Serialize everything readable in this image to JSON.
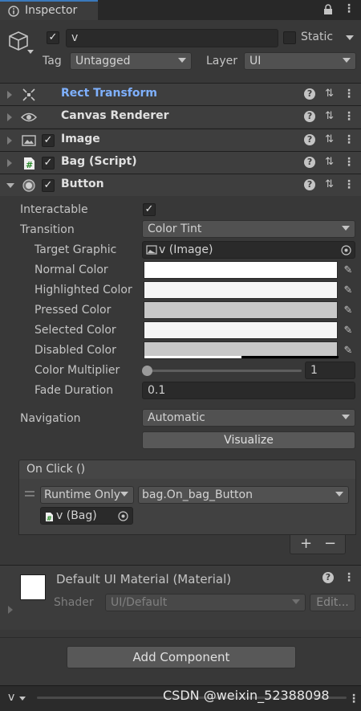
{
  "tab": {
    "title": "Inspector"
  },
  "object": {
    "name": "v",
    "static_label": "Static",
    "tag_label": "Tag",
    "tag_value": "Untagged",
    "layer_label": "Layer",
    "layer_value": "UI"
  },
  "components": [
    {
      "name": "Rect Transform"
    },
    {
      "name": "Canvas Renderer"
    },
    {
      "name": "Image"
    },
    {
      "name": "Bag (Script)"
    },
    {
      "name": "Button"
    }
  ],
  "button": {
    "interactable_label": "Interactable",
    "transition_label": "Transition",
    "transition_value": "Color Tint",
    "target_graphic_label": "Target Graphic",
    "target_graphic_value": "v (Image)",
    "normal_color_label": "Normal Color",
    "highlighted_color_label": "Highlighted Color",
    "pressed_color_label": "Pressed Color",
    "selected_color_label": "Selected Color",
    "disabled_color_label": "Disabled Color",
    "color_multiplier_label": "Color Multiplier",
    "color_multiplier_value": "1",
    "fade_duration_label": "Fade Duration",
    "fade_duration_value": "0.1",
    "navigation_label": "Navigation",
    "navigation_value": "Automatic",
    "visualize_label": "Visualize"
  },
  "onclick": {
    "header": "On Click ()",
    "runtime_value": "Runtime Only",
    "function_value": "bag.On_bag_Button",
    "object_value": "v (Bag)",
    "plus": "+",
    "minus": "−"
  },
  "material": {
    "name": "Default UI Material (Material)",
    "shader_label": "Shader",
    "shader_value": "UI/Default",
    "edit_label": "Edit..."
  },
  "add_component_label": "Add Component",
  "footer": {
    "layer_value": "v",
    "watermark": "CSDN @weixin_52388098"
  },
  "colors": {
    "normal": "#ffffff",
    "highlighted": "#f5f5f5",
    "pressed": "#c8c8c8",
    "selected": "#f5f5f5",
    "disabled": "#c8c8c8",
    "accent_link": "#7fb1ff"
  }
}
